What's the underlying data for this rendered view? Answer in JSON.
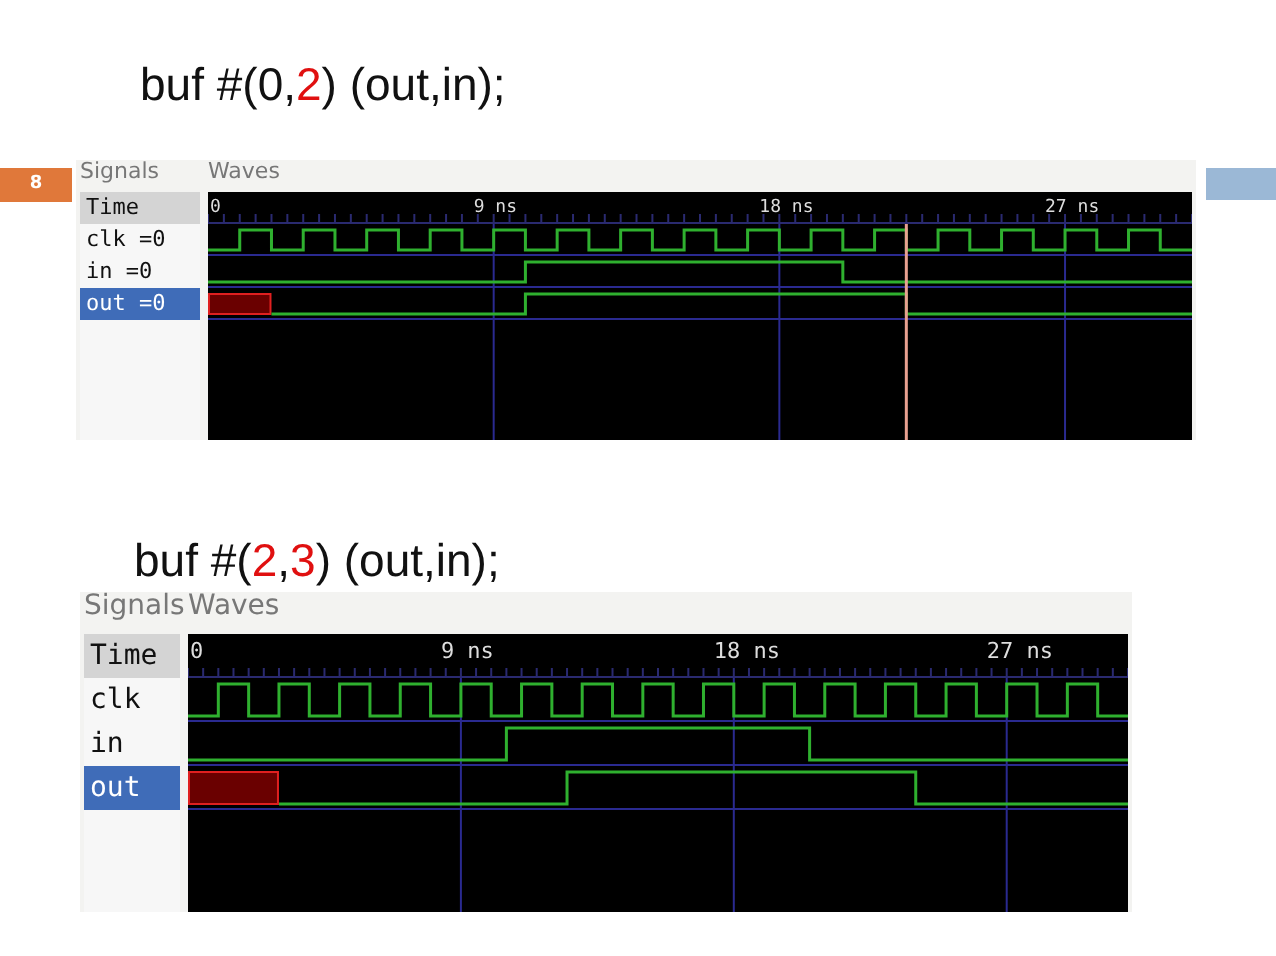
{
  "slide_number": "8",
  "panels": [
    {
      "title": [
        {
          "text": "buf #(0,",
          "highlight": false
        },
        {
          "text": "2",
          "highlight": true
        },
        {
          "text": ") (out,in);",
          "highlight": false
        }
      ],
      "signals_label": "Signals",
      "waves_label": "Waves",
      "signals": [
        {
          "name": "Time",
          "kind": "header",
          "selected": false
        },
        {
          "name": "clk =0",
          "kind": "signal",
          "selected": false
        },
        {
          "name": "in =0",
          "kind": "signal",
          "selected": false
        },
        {
          "name": "out =0",
          "kind": "signal",
          "selected": true
        }
      ],
      "time_labels": [
        "0",
        "9 ns",
        "18 ns",
        "27 ns"
      ]
    },
    {
      "title": [
        {
          "text": "buf #(",
          "highlight": false
        },
        {
          "text": "2",
          "highlight": true
        },
        {
          "text": ",",
          "highlight": false
        },
        {
          "text": "3",
          "highlight": true
        },
        {
          "text": ") (out,in);",
          "highlight": false
        }
      ],
      "signals_label": "Signals",
      "waves_label": "Waves",
      "signals": [
        {
          "name": "Time",
          "kind": "header",
          "selected": false
        },
        {
          "name": "clk",
          "kind": "signal",
          "selected": false
        },
        {
          "name": "in",
          "kind": "signal",
          "selected": false
        },
        {
          "name": "out",
          "kind": "signal",
          "selected": true
        }
      ],
      "time_labels": [
        "0",
        "9 ns",
        "18 ns",
        "27 ns"
      ]
    }
  ]
}
